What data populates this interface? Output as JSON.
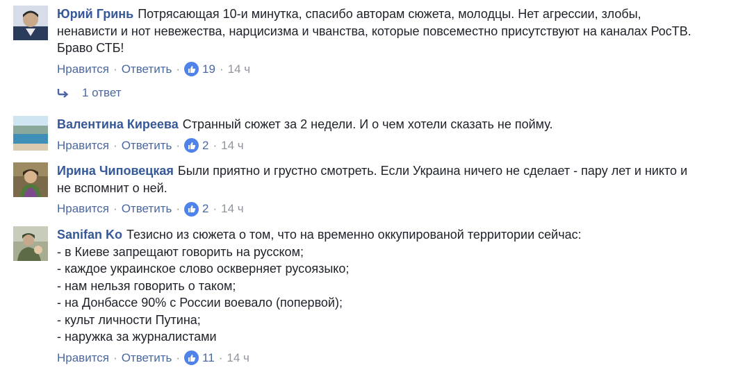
{
  "comments": [
    {
      "author": "Юрий Гринь",
      "text": "Потрясающая 10-и минутка, спасибо авторам сюжета, молодцы. Нет агрессии, злобы,\nненависти и нот невежества, нарцисизма и чванства, которые повсеместно присутствуют на каналах РосТВ.\nБраво СТБ!",
      "like_label": "Нравится",
      "reply_label": "Ответить",
      "likes": "19",
      "time": "14 ч",
      "avatar_colors": [
        "#2a3b5c",
        "#c9a98a"
      ]
    },
    {
      "author": "Валентина Киреева",
      "text": "Странный сюжет за 2 недели. И о чем хотели сказать не пойму.",
      "like_label": "Нравится",
      "reply_label": "Ответить",
      "likes": "2",
      "time": "14 ч",
      "avatar_colors": [
        "#8fc3e0",
        "#3f8fb8"
      ]
    },
    {
      "author": "Ирина Чиповецкая",
      "text": "Были приятно и грустно смотреть. Если Украина ничего не сделает - пару лет и никто и\nне вспомнит о ней.",
      "like_label": "Нравится",
      "reply_label": "Ответить",
      "likes": "2",
      "time": "14 ч",
      "avatar_colors": [
        "#3a2a1e",
        "#6a8a4a"
      ]
    },
    {
      "author": "Sanifan Ko",
      "text": "Тезисно из сюжета о том, что на временно оккупированой территории сейчас:\n- в Киеве запрещают говорить на русском;\n- каждое украинское слово оскверняет русоязыко;\n- нам нельзя говорить о таком;\n- на Донбассе 90% с России воевало (попервой);\n- культ личности Путина;\n- наружка за журналистами",
      "like_label": "Нравится",
      "reply_label": "Ответить",
      "likes": "11",
      "time": "14 ч",
      "avatar_colors": [
        "#6a7358",
        "#c8b59a"
      ]
    }
  ],
  "replies_link": {
    "label": "1 ответ"
  },
  "colors": {
    "author": "#365899",
    "link": "#4b67a1",
    "meta": "#90949c",
    "like_badge": "#4f83ea"
  }
}
